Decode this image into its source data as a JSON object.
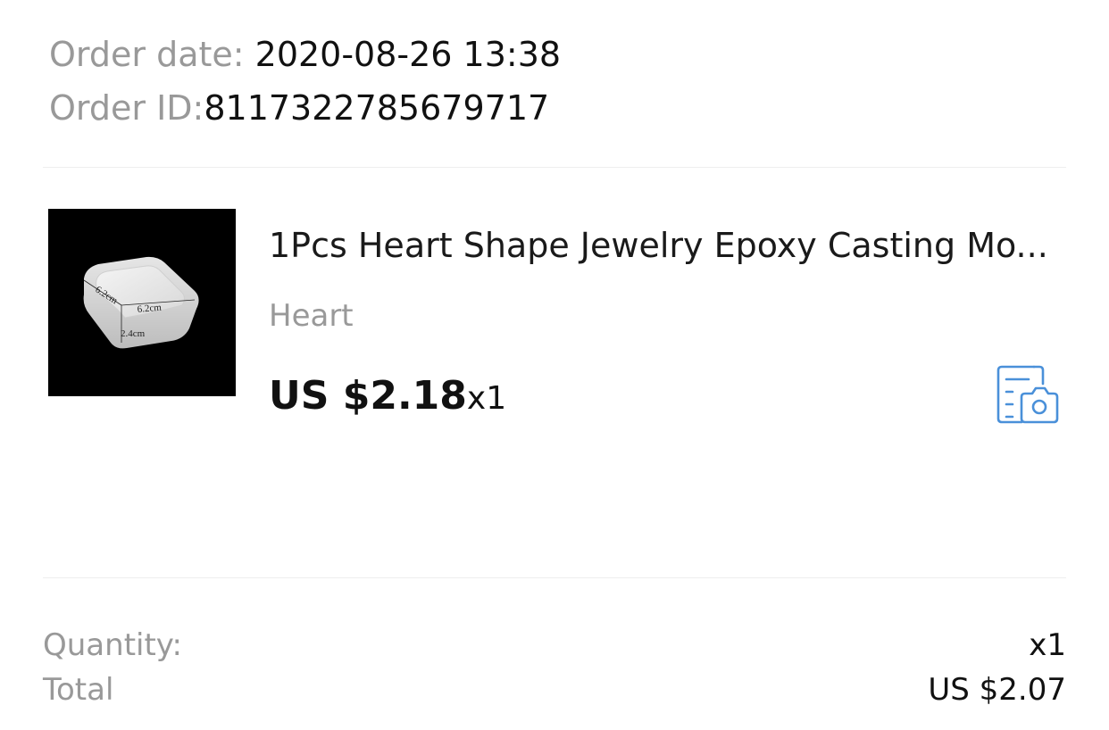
{
  "order": {
    "date_label": "Order date: ",
    "date_value": "2020-08-26 13:38",
    "id_label": "Order ID:",
    "id_value": "8117322785679717"
  },
  "product": {
    "title": "1Pcs Heart Shape Jewelry Epoxy Casting Mo...",
    "variant": "Heart",
    "price": "US $2.18",
    "quantity": "x1",
    "image_dimensions": {
      "width": "6.2cm",
      "depth": "6.2cm",
      "height": "2.4cm"
    },
    "review_icon": "photo-review-icon"
  },
  "summary": {
    "quantity_label": "Quantity:",
    "quantity_value": "x1",
    "total_label": "Total",
    "total_value": "US $2.07"
  },
  "colors": {
    "label_gray": "#999999",
    "text_dark": "#111111",
    "icon_blue": "#4a90d9"
  }
}
